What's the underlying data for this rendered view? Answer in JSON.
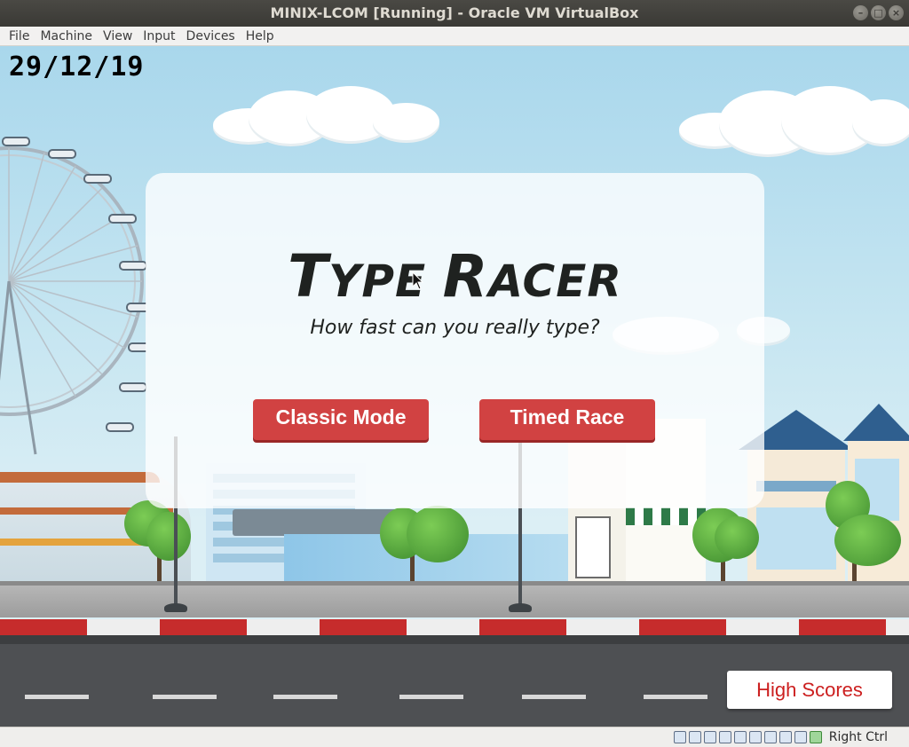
{
  "window": {
    "title": "MINIX-LCOM [Running] - Oracle VM VirtualBox",
    "buttons": [
      "–",
      "□",
      "×"
    ]
  },
  "menu": {
    "items": [
      "File",
      "Machine",
      "View",
      "Input",
      "Devices",
      "Help"
    ]
  },
  "game": {
    "date": "29/12/19",
    "title_first_initial": "T",
    "title_first_rest": "YPE",
    "title_second_initial": "R",
    "title_second_rest": "ACER",
    "subtitle": "How fast can you really type?",
    "classic_mode_label": "Classic Mode",
    "timed_race_label": "Timed Race",
    "high_scores_label": "High Scores"
  },
  "statusbar": {
    "host_key": "Right Ctrl",
    "icons": [
      "hard-disk-icon",
      "optical-drive-icon",
      "audio-icon",
      "network-icon",
      "usb-icon",
      "shared-folders-icon",
      "display-icon",
      "video-capture-icon",
      "mouse-integration-icon",
      "keyboard-icon"
    ]
  },
  "colors": {
    "button_red": "#d14242",
    "high_scores_text": "#cc1f1f",
    "sky": "#c5e5f1"
  }
}
